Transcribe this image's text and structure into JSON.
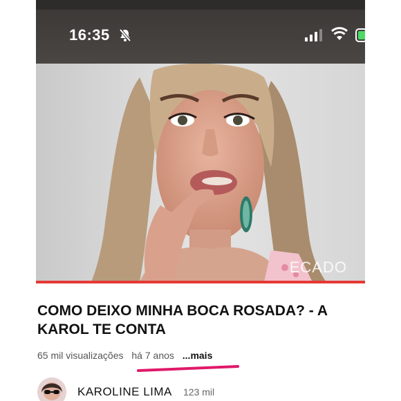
{
  "status_bar": {
    "time": "16:35",
    "icons": [
      "bell-slash-icon",
      "signal-icon",
      "wifi-icon",
      "battery-icon"
    ]
  },
  "player": {
    "watermark": "ECADO",
    "progress_fraction": 1.0,
    "progress_color": "#e53935"
  },
  "video": {
    "title": "COMO DEIXO MINHA BOCA ROSADA? - A KAROL TE CONTA",
    "views": "65 mil visualizações",
    "age": "há 7 anos",
    "more_label": "...mais",
    "underline_color": "#e0196a"
  },
  "channel": {
    "name": "KAROLINE LIMA",
    "subscribers": "123 mil"
  }
}
